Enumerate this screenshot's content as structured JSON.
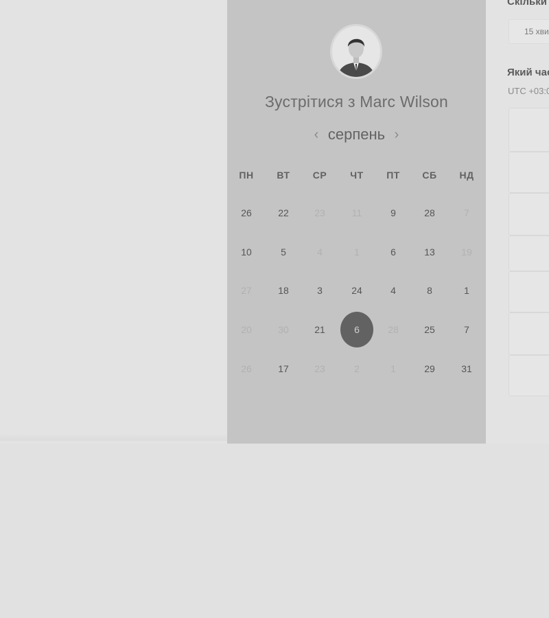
{
  "meeting": {
    "title": "Зустрітися з Marc Wilson",
    "avatar_icon": "person-portrait"
  },
  "calendar": {
    "month": "серпень",
    "prev_icon": "chevron-left-icon",
    "next_icon": "chevron-right-icon",
    "weekdays": [
      "ПН",
      "ВТ",
      "СР",
      "ЧТ",
      "ПТ",
      "СБ",
      "НД"
    ],
    "selected_day": "6",
    "weeks": [
      [
        {
          "d": "26",
          "on": true
        },
        {
          "d": "22",
          "on": true
        },
        {
          "d": "23",
          "on": false
        },
        {
          "d": "11",
          "on": false
        },
        {
          "d": "9",
          "on": true
        },
        {
          "d": "28",
          "on": true
        },
        {
          "d": "7",
          "on": false
        }
      ],
      [
        {
          "d": "10",
          "on": true
        },
        {
          "d": "5",
          "on": true
        },
        {
          "d": "4",
          "on": false
        },
        {
          "d": "1",
          "on": false
        },
        {
          "d": "6",
          "on": true
        },
        {
          "d": "13",
          "on": true
        },
        {
          "d": "19",
          "on": false
        }
      ],
      [
        {
          "d": "27",
          "on": false
        },
        {
          "d": "18",
          "on": true
        },
        {
          "d": "3",
          "on": true
        },
        {
          "d": "24",
          "on": true
        },
        {
          "d": "4",
          "on": true
        },
        {
          "d": "8",
          "on": true
        },
        {
          "d": "1",
          "on": true
        }
      ],
      [
        {
          "d": "20",
          "on": false
        },
        {
          "d": "30",
          "on": false
        },
        {
          "d": "21",
          "on": true
        },
        {
          "d": "6",
          "on": true,
          "selected": true
        },
        {
          "d": "28",
          "on": false
        },
        {
          "d": "25",
          "on": true
        },
        {
          "d": "7",
          "on": true
        }
      ],
      [
        {
          "d": "26",
          "on": false
        },
        {
          "d": "17",
          "on": true
        },
        {
          "d": "23",
          "on": false
        },
        {
          "d": "2",
          "on": false
        },
        {
          "d": "1",
          "on": false
        },
        {
          "d": "29",
          "on": true
        },
        {
          "d": "31",
          "on": true
        }
      ]
    ]
  },
  "side": {
    "duration_question": "Скільки",
    "duration_value": "15 хвил",
    "time_question": "Який час",
    "timezone": "UTC +03:0"
  },
  "colors": {
    "panel": "#c4c4c4",
    "background": "#e3e3e3",
    "selected": "#626262"
  }
}
